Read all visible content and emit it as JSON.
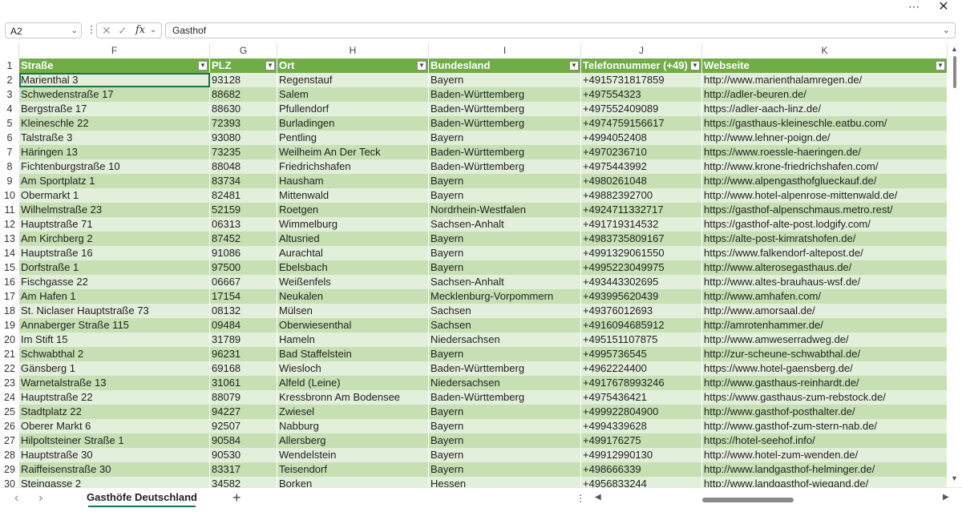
{
  "window": {
    "more_icon": "⋯",
    "close_icon": "✕"
  },
  "formula_bar": {
    "name_box": "A2",
    "cancel_icon": "✕",
    "enter_icon": "✓",
    "fx_label": "fx",
    "value": "Gasthof"
  },
  "columns": [
    "F",
    "G",
    "H",
    "I",
    "J",
    "K"
  ],
  "headers": [
    "Straße",
    "PLZ",
    "Ort",
    "Bundesland",
    "Telefonnummer (+49)",
    "Webseite"
  ],
  "rows": [
    [
      "Marienthal 3",
      "93128",
      "Regenstauf",
      "Bayern",
      "+4915731817859",
      "http://www.marienthalamregen.de/"
    ],
    [
      "Schwedenstraße 17",
      "88682",
      "Salem",
      "Baden-Württemberg",
      "+497554323",
      "http://adler-beuren.de/"
    ],
    [
      "Bergstraße 17",
      "88630",
      "Pfullendorf",
      "Baden-Württemberg",
      "+497552409089",
      "https://adler-aach-linz.de/"
    ],
    [
      "Kleineschle 22",
      "72393",
      "Burladingen",
      "Baden-Württemberg",
      "+4974759156617",
      "https://gasthaus-kleineschle.eatbu.com/"
    ],
    [
      "Talstraße 3",
      "93080",
      "Pentling",
      "Bayern",
      "+4994052408",
      "http://www.lehner-poign.de/"
    ],
    [
      "Häringen 13",
      "73235",
      "Weilheim An Der Teck",
      "Baden-Württemberg",
      "+4970236710",
      "https://www.roessle-haeringen.de/"
    ],
    [
      "Fichtenburgstraße 10",
      "88048",
      "Friedrichshafen",
      "Baden-Württemberg",
      "+4975443992",
      "http://www.krone-friedrichshafen.com/"
    ],
    [
      "Am Sportplatz 1",
      "83734",
      "Hausham",
      "Bayern",
      "+4980261048",
      "http://www.alpengasthofglueckauf.de/"
    ],
    [
      "Obermarkt 1",
      "82481",
      "Mittenwald",
      "Bayern",
      "+49882392700",
      "http://www.hotel-alpenrose-mittenwald.de/"
    ],
    [
      "Wilhelmstraße 23",
      "52159",
      "Roetgen",
      "Nordrhein-Westfalen",
      "+4924711332717",
      "https://gasthof-alpenschmaus.metro.rest/"
    ],
    [
      "Hauptstraße 71",
      "06313",
      "Wimmelburg",
      "Sachsen-Anhalt",
      "+491719314532",
      "https://gasthof-alte-post.lodgify.com/"
    ],
    [
      "Am Kirchberg 2",
      "87452",
      "Altusried",
      "Bayern",
      "+4983735809167",
      "https://alte-post-kimratshofen.de/"
    ],
    [
      "Hauptstraße 16",
      "91086",
      "Aurachtal",
      "Bayern",
      "+4991329061550",
      "https://www.falkendorf-altepost.de/"
    ],
    [
      "Dorfstraße 1",
      "97500",
      "Ebelsbach",
      "Bayern",
      "+4995223049975",
      "http://www.alterosegasthaus.de/"
    ],
    [
      "Fischgasse 22",
      "06667",
      "Weißenfels",
      "Sachsen-Anhalt",
      "+493443302695",
      "http://www.altes-brauhaus-wsf.de/"
    ],
    [
      "Am Hafen 1",
      "17154",
      "Neukalen",
      "Mecklenburg-Vorpommern",
      "+493995620439",
      "http://www.amhafen.com/"
    ],
    [
      "St. Niclaser Hauptstraße 73",
      "08132",
      "Mülsen",
      "Sachsen",
      "+49376012693",
      "http://www.amorsaal.de/"
    ],
    [
      "Annaberger Straße 115",
      "09484",
      "Oberwiesenthal",
      "Sachsen",
      "+4916094685912",
      "http://amrotenhammer.de/"
    ],
    [
      "Im Stift 15",
      "31789",
      "Hameln",
      "Niedersachsen",
      "+495151107875",
      "http://www.amweserradweg.de/"
    ],
    [
      "Schwabthal 2",
      "96231",
      "Bad Staffelstein",
      "Bayern",
      "+4995736545",
      "http://zur-scheune-schwabthal.de/"
    ],
    [
      "Gänsberg 1",
      "69168",
      "Wiesloch",
      "Baden-Württemberg",
      "+4962224400",
      "https://www.hotel-gaensberg.de/"
    ],
    [
      "Warnetalstraße 13",
      "31061",
      "Alfeld (Leine)",
      "Niedersachsen",
      "+4917678993246",
      "http://www.gasthaus-reinhardt.de/"
    ],
    [
      "Hauptstraße 22",
      "88079",
      "Kressbronn Am Bodensee",
      "Baden-Württemberg",
      "+4975436421",
      "https://www.gasthaus-zum-rebstock.de/"
    ],
    [
      "Stadtplatz 22",
      "94227",
      "Zwiesel",
      "Bayern",
      "+499922804900",
      "http://www.gasthof-posthalter.de/"
    ],
    [
      "Oberer Markt 6",
      "92507",
      "Nabburg",
      "Bayern",
      "+4994339628",
      "http://www.gasthof-zum-stern-nab.de/"
    ],
    [
      "Hilpoltsteiner Straße 1",
      "90584",
      "Allersberg",
      "Bayern",
      "+499176275",
      "https://hotel-seehof.info/"
    ],
    [
      "Hauptstraße 30",
      "90530",
      "Wendelstein",
      "Bayern",
      "+49912990130",
      "http://www.hotel-zum-wenden.de/"
    ],
    [
      "Raiffeisenstraße 30",
      "83317",
      "Teisendorf",
      "Bayern",
      "+498666339",
      "http://www.landgasthof-helminger.de/"
    ],
    [
      "Steingasse 2",
      "34582",
      "Borken",
      "Hessen",
      "+4956833244",
      "http://www.landgasthof-wiegand.de/"
    ]
  ],
  "sheet_tab": "Gasthöfe Deutschland",
  "add_sheet_icon": "+",
  "colors": {
    "header_green": "#70ad47",
    "band_light": "#e2efda",
    "band_dark": "#c6e0b4",
    "accent": "#1e7145"
  }
}
